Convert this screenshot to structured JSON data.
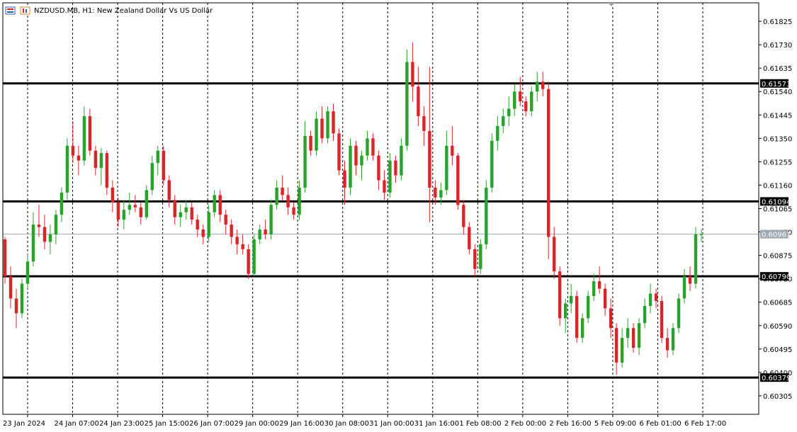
{
  "header": {
    "symbol": "NZDUSD.MB",
    "timeframe": "H1",
    "description": "New Zealand Dollar Vs US Dollar"
  },
  "colors": {
    "bull": "#2ca02c",
    "bear": "#d62728",
    "grid": "#000000",
    "level_line": "#000000",
    "current_price_line": "#a0a8b0",
    "current_price_label": "#a0a8b0",
    "level_label_bg": "#000000"
  },
  "chart_data": {
    "type": "candlestick",
    "title": "",
    "xlabel": "",
    "ylabel": "",
    "ylim": [
      0.6023,
      0.619
    ],
    "y_ticks": [
      0.61825,
      0.6173,
      0.61635,
      0.6154,
      0.61445,
      0.6135,
      0.61255,
      0.6116,
      0.61065,
      0.6097,
      0.60875,
      0.6078,
      0.60685,
      0.6059,
      0.60495,
      0.604,
      0.60305
    ],
    "x_ticks": [
      "23 Jan 2024",
      "24 Jan 07:00",
      "24 Jan 23:00",
      "25 Jan 15:00",
      "26 Jan 07:00",
      "29 Jan 00:00",
      "29 Jan 16:00",
      "30 Jan 08:00",
      "31 Jan 00:00",
      "31 Jan 16:00",
      "1 Feb 08:00",
      "2 Feb 00:00",
      "2 Feb 16:00",
      "5 Feb 09:00",
      "6 Feb 01:00",
      "6 Feb 17:00"
    ],
    "grid": "vertical dashed",
    "horizontal_levels": [
      0.61573,
      0.61094,
      0.6079,
      0.60379
    ],
    "current_price": 0.60961,
    "ohlc": [
      [
        0.6094,
        0.6095,
        0.6076,
        0.6079
      ],
      [
        0.6079,
        0.6083,
        0.6066,
        0.607
      ],
      [
        0.607,
        0.6074,
        0.6058,
        0.6064
      ],
      [
        0.6064,
        0.6078,
        0.6062,
        0.6076
      ],
      [
        0.6076,
        0.6088,
        0.6074,
        0.6085
      ],
      [
        0.6085,
        0.6105,
        0.6083,
        0.61
      ],
      [
        0.61,
        0.6108,
        0.6095,
        0.6099
      ],
      [
        0.6099,
        0.6104,
        0.609,
        0.6093
      ],
      [
        0.6093,
        0.61,
        0.6088,
        0.6096
      ],
      [
        0.6096,
        0.6106,
        0.6092,
        0.6104
      ],
      [
        0.6104,
        0.6115,
        0.6101,
        0.6113
      ],
      [
        0.6113,
        0.6135,
        0.611,
        0.6132
      ],
      [
        0.6132,
        0.6142,
        0.6125,
        0.6128
      ],
      [
        0.6128,
        0.6132,
        0.612,
        0.6126
      ],
      [
        0.6126,
        0.6148,
        0.6124,
        0.6144
      ],
      [
        0.6144,
        0.6147,
        0.6128,
        0.613
      ],
      [
        0.613,
        0.6132,
        0.612,
        0.6123
      ],
      [
        0.6123,
        0.6131,
        0.6116,
        0.6129
      ],
      [
        0.6129,
        0.613,
        0.6112,
        0.6115
      ],
      [
        0.6115,
        0.6118,
        0.6105,
        0.6109
      ],
      [
        0.6109,
        0.6111,
        0.6099,
        0.6102
      ],
      [
        0.6102,
        0.611,
        0.6098,
        0.6106
      ],
      [
        0.6106,
        0.6113,
        0.6104,
        0.6108
      ],
      [
        0.6108,
        0.6112,
        0.6105,
        0.6107
      ],
      [
        0.6107,
        0.6109,
        0.61,
        0.6103
      ],
      [
        0.6103,
        0.6116,
        0.6102,
        0.6114
      ],
      [
        0.6114,
        0.6128,
        0.6112,
        0.6125
      ],
      [
        0.6125,
        0.6132,
        0.612,
        0.613
      ],
      [
        0.613,
        0.6132,
        0.6116,
        0.6118
      ],
      [
        0.6118,
        0.612,
        0.6107,
        0.611
      ],
      [
        0.611,
        0.6112,
        0.61,
        0.6103
      ],
      [
        0.6103,
        0.6108,
        0.6099,
        0.6105
      ],
      [
        0.6105,
        0.611,
        0.6102,
        0.6107
      ],
      [
        0.6107,
        0.6109,
        0.61,
        0.6102
      ],
      [
        0.6102,
        0.6104,
        0.6095,
        0.6098
      ],
      [
        0.6098,
        0.61,
        0.6092,
        0.6095
      ],
      [
        0.6095,
        0.6108,
        0.6093,
        0.6105
      ],
      [
        0.6105,
        0.6114,
        0.6103,
        0.6112
      ],
      [
        0.6112,
        0.6114,
        0.6101,
        0.6104
      ],
      [
        0.6104,
        0.6106,
        0.6096,
        0.61
      ],
      [
        0.61,
        0.6102,
        0.6092,
        0.6095
      ],
      [
        0.6095,
        0.6098,
        0.6088,
        0.6092
      ],
      [
        0.6092,
        0.6096,
        0.6088,
        0.609
      ],
      [
        0.609,
        0.6092,
        0.6078,
        0.608
      ],
      [
        0.608,
        0.6096,
        0.6079,
        0.6094
      ],
      [
        0.6094,
        0.61,
        0.6092,
        0.6098
      ],
      [
        0.6098,
        0.6102,
        0.6094,
        0.6096
      ],
      [
        0.6096,
        0.611,
        0.6094,
        0.6108
      ],
      [
        0.6108,
        0.6118,
        0.6106,
        0.6115
      ],
      [
        0.6115,
        0.612,
        0.611,
        0.6112
      ],
      [
        0.6112,
        0.6115,
        0.6104,
        0.6107
      ],
      [
        0.6107,
        0.6109,
        0.6102,
        0.6104
      ],
      [
        0.6104,
        0.6118,
        0.6102,
        0.6115
      ],
      [
        0.6115,
        0.6142,
        0.6113,
        0.6136
      ],
      [
        0.6136,
        0.6138,
        0.6128,
        0.613
      ],
      [
        0.613,
        0.6146,
        0.6128,
        0.6143
      ],
      [
        0.6143,
        0.6148,
        0.6133,
        0.6135
      ],
      [
        0.6135,
        0.6148,
        0.6133,
        0.6146
      ],
      [
        0.6146,
        0.6149,
        0.6134,
        0.6137
      ],
      [
        0.6137,
        0.6139,
        0.612,
        0.6122
      ],
      [
        0.6122,
        0.6126,
        0.6108,
        0.6115
      ],
      [
        0.6115,
        0.6135,
        0.6112,
        0.6132
      ],
      [
        0.6132,
        0.6134,
        0.612,
        0.6124
      ],
      [
        0.6124,
        0.613,
        0.6118,
        0.6128
      ],
      [
        0.6128,
        0.6138,
        0.6126,
        0.6135
      ],
      [
        0.6135,
        0.6137,
        0.6126,
        0.6128
      ],
      [
        0.6128,
        0.613,
        0.6114,
        0.6118
      ],
      [
        0.6118,
        0.6122,
        0.611,
        0.6113
      ],
      [
        0.6113,
        0.6129,
        0.6111,
        0.6126
      ],
      [
        0.6126,
        0.6128,
        0.6117,
        0.612
      ],
      [
        0.612,
        0.6135,
        0.6118,
        0.6132
      ],
      [
        0.6132,
        0.6171,
        0.613,
        0.6166
      ],
      [
        0.6166,
        0.6174,
        0.615,
        0.6156
      ],
      [
        0.6156,
        0.6164,
        0.614,
        0.6144
      ],
      [
        0.6144,
        0.6148,
        0.6132,
        0.6138
      ],
      [
        0.6138,
        0.6164,
        0.6101,
        0.6115
      ],
      [
        0.6115,
        0.6118,
        0.6108,
        0.6111
      ],
      [
        0.6111,
        0.6117,
        0.6108,
        0.6114
      ],
      [
        0.6114,
        0.6138,
        0.6112,
        0.6132
      ],
      [
        0.6132,
        0.614,
        0.6124,
        0.6128
      ],
      [
        0.6128,
        0.6129,
        0.6106,
        0.6108
      ],
      [
        0.6108,
        0.611,
        0.6096,
        0.6099
      ],
      [
        0.6099,
        0.6101,
        0.6088,
        0.609
      ],
      [
        0.609,
        0.6092,
        0.6079,
        0.6082
      ],
      [
        0.6082,
        0.6094,
        0.608,
        0.6092
      ],
      [
        0.6092,
        0.6118,
        0.609,
        0.6115
      ],
      [
        0.6115,
        0.6137,
        0.6113,
        0.6134
      ],
      [
        0.6134,
        0.6144,
        0.613,
        0.614
      ],
      [
        0.614,
        0.6147,
        0.6137,
        0.6144
      ],
      [
        0.6144,
        0.6152,
        0.614,
        0.6147
      ],
      [
        0.6147,
        0.6157,
        0.6144,
        0.6154
      ],
      [
        0.6154,
        0.616,
        0.6148,
        0.615
      ],
      [
        0.615,
        0.6152,
        0.6144,
        0.6146
      ],
      [
        0.6146,
        0.6156,
        0.6144,
        0.6154
      ],
      [
        0.6154,
        0.6162,
        0.615,
        0.6158
      ],
      [
        0.6158,
        0.6162,
        0.6152,
        0.6155
      ],
      [
        0.6155,
        0.6158,
        0.6086,
        0.6095
      ],
      [
        0.6095,
        0.6099,
        0.6078,
        0.6081
      ],
      [
        0.6081,
        0.6083,
        0.6059,
        0.6062
      ],
      [
        0.6062,
        0.607,
        0.6056,
        0.6068
      ],
      [
        0.6068,
        0.6076,
        0.6064,
        0.6071
      ],
      [
        0.6071,
        0.6073,
        0.6052,
        0.6054
      ],
      [
        0.6054,
        0.6064,
        0.6052,
        0.6062
      ],
      [
        0.6062,
        0.6073,
        0.606,
        0.6071
      ],
      [
        0.6071,
        0.608,
        0.6069,
        0.6077
      ],
      [
        0.6077,
        0.6083,
        0.6072,
        0.6074
      ],
      [
        0.6074,
        0.6076,
        0.6063,
        0.6066
      ],
      [
        0.6066,
        0.607,
        0.6054,
        0.6058
      ],
      [
        0.6058,
        0.606,
        0.6039,
        0.6044
      ],
      [
        0.6044,
        0.6058,
        0.6042,
        0.6054
      ],
      [
        0.6054,
        0.6062,
        0.605,
        0.6058
      ],
      [
        0.6058,
        0.606,
        0.6048,
        0.605
      ],
      [
        0.605,
        0.6062,
        0.6047,
        0.606
      ],
      [
        0.606,
        0.607,
        0.6058,
        0.6067
      ],
      [
        0.6067,
        0.6076,
        0.6064,
        0.6072
      ],
      [
        0.6072,
        0.6074,
        0.6066,
        0.6069
      ],
      [
        0.6069,
        0.6071,
        0.6052,
        0.6054
      ],
      [
        0.6054,
        0.6058,
        0.6046,
        0.6049
      ],
      [
        0.6049,
        0.606,
        0.6047,
        0.6058
      ],
      [
        0.6058,
        0.6072,
        0.6056,
        0.607
      ],
      [
        0.607,
        0.6082,
        0.6068,
        0.6079
      ],
      [
        0.6079,
        0.6083,
        0.6073,
        0.6076
      ],
      [
        0.6076,
        0.6099,
        0.6074,
        0.6096
      ],
      [
        0.6096,
        0.6098,
        0.6093,
        0.6096
      ]
    ]
  }
}
